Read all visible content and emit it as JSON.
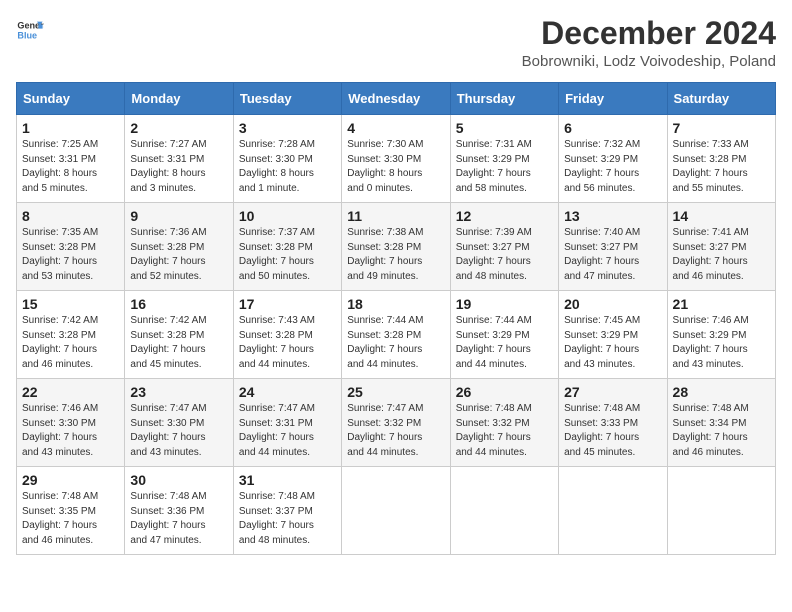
{
  "logo": {
    "text_general": "General",
    "text_blue": "Blue"
  },
  "title": "December 2024",
  "subtitle": "Bobrowniki, Lodz Voivodeship, Poland",
  "headers": [
    "Sunday",
    "Monday",
    "Tuesday",
    "Wednesday",
    "Thursday",
    "Friday",
    "Saturday"
  ],
  "weeks": [
    [
      {
        "day": "1",
        "info": "Sunrise: 7:25 AM\nSunset: 3:31 PM\nDaylight: 8 hours\nand 5 minutes."
      },
      {
        "day": "2",
        "info": "Sunrise: 7:27 AM\nSunset: 3:31 PM\nDaylight: 8 hours\nand 3 minutes."
      },
      {
        "day": "3",
        "info": "Sunrise: 7:28 AM\nSunset: 3:30 PM\nDaylight: 8 hours\nand 1 minute."
      },
      {
        "day": "4",
        "info": "Sunrise: 7:30 AM\nSunset: 3:30 PM\nDaylight: 8 hours\nand 0 minutes."
      },
      {
        "day": "5",
        "info": "Sunrise: 7:31 AM\nSunset: 3:29 PM\nDaylight: 7 hours\nand 58 minutes."
      },
      {
        "day": "6",
        "info": "Sunrise: 7:32 AM\nSunset: 3:29 PM\nDaylight: 7 hours\nand 56 minutes."
      },
      {
        "day": "7",
        "info": "Sunrise: 7:33 AM\nSunset: 3:28 PM\nDaylight: 7 hours\nand 55 minutes."
      }
    ],
    [
      {
        "day": "8",
        "info": "Sunrise: 7:35 AM\nSunset: 3:28 PM\nDaylight: 7 hours\nand 53 minutes."
      },
      {
        "day": "9",
        "info": "Sunrise: 7:36 AM\nSunset: 3:28 PM\nDaylight: 7 hours\nand 52 minutes."
      },
      {
        "day": "10",
        "info": "Sunrise: 7:37 AM\nSunset: 3:28 PM\nDaylight: 7 hours\nand 50 minutes."
      },
      {
        "day": "11",
        "info": "Sunrise: 7:38 AM\nSunset: 3:28 PM\nDaylight: 7 hours\nand 49 minutes."
      },
      {
        "day": "12",
        "info": "Sunrise: 7:39 AM\nSunset: 3:27 PM\nDaylight: 7 hours\nand 48 minutes."
      },
      {
        "day": "13",
        "info": "Sunrise: 7:40 AM\nSunset: 3:27 PM\nDaylight: 7 hours\nand 47 minutes."
      },
      {
        "day": "14",
        "info": "Sunrise: 7:41 AM\nSunset: 3:27 PM\nDaylight: 7 hours\nand 46 minutes."
      }
    ],
    [
      {
        "day": "15",
        "info": "Sunrise: 7:42 AM\nSunset: 3:28 PM\nDaylight: 7 hours\nand 46 minutes."
      },
      {
        "day": "16",
        "info": "Sunrise: 7:42 AM\nSunset: 3:28 PM\nDaylight: 7 hours\nand 45 minutes."
      },
      {
        "day": "17",
        "info": "Sunrise: 7:43 AM\nSunset: 3:28 PM\nDaylight: 7 hours\nand 44 minutes."
      },
      {
        "day": "18",
        "info": "Sunrise: 7:44 AM\nSunset: 3:28 PM\nDaylight: 7 hours\nand 44 minutes."
      },
      {
        "day": "19",
        "info": "Sunrise: 7:44 AM\nSunset: 3:29 PM\nDaylight: 7 hours\nand 44 minutes."
      },
      {
        "day": "20",
        "info": "Sunrise: 7:45 AM\nSunset: 3:29 PM\nDaylight: 7 hours\nand 43 minutes."
      },
      {
        "day": "21",
        "info": "Sunrise: 7:46 AM\nSunset: 3:29 PM\nDaylight: 7 hours\nand 43 minutes."
      }
    ],
    [
      {
        "day": "22",
        "info": "Sunrise: 7:46 AM\nSunset: 3:30 PM\nDaylight: 7 hours\nand 43 minutes."
      },
      {
        "day": "23",
        "info": "Sunrise: 7:47 AM\nSunset: 3:30 PM\nDaylight: 7 hours\nand 43 minutes."
      },
      {
        "day": "24",
        "info": "Sunrise: 7:47 AM\nSunset: 3:31 PM\nDaylight: 7 hours\nand 44 minutes."
      },
      {
        "day": "25",
        "info": "Sunrise: 7:47 AM\nSunset: 3:32 PM\nDaylight: 7 hours\nand 44 minutes."
      },
      {
        "day": "26",
        "info": "Sunrise: 7:48 AM\nSunset: 3:32 PM\nDaylight: 7 hours\nand 44 minutes."
      },
      {
        "day": "27",
        "info": "Sunrise: 7:48 AM\nSunset: 3:33 PM\nDaylight: 7 hours\nand 45 minutes."
      },
      {
        "day": "28",
        "info": "Sunrise: 7:48 AM\nSunset: 3:34 PM\nDaylight: 7 hours\nand 46 minutes."
      }
    ],
    [
      {
        "day": "29",
        "info": "Sunrise: 7:48 AM\nSunset: 3:35 PM\nDaylight: 7 hours\nand 46 minutes."
      },
      {
        "day": "30",
        "info": "Sunrise: 7:48 AM\nSunset: 3:36 PM\nDaylight: 7 hours\nand 47 minutes."
      },
      {
        "day": "31",
        "info": "Sunrise: 7:48 AM\nSunset: 3:37 PM\nDaylight: 7 hours\nand 48 minutes."
      },
      {
        "day": "",
        "info": ""
      },
      {
        "day": "",
        "info": ""
      },
      {
        "day": "",
        "info": ""
      },
      {
        "day": "",
        "info": ""
      }
    ]
  ]
}
